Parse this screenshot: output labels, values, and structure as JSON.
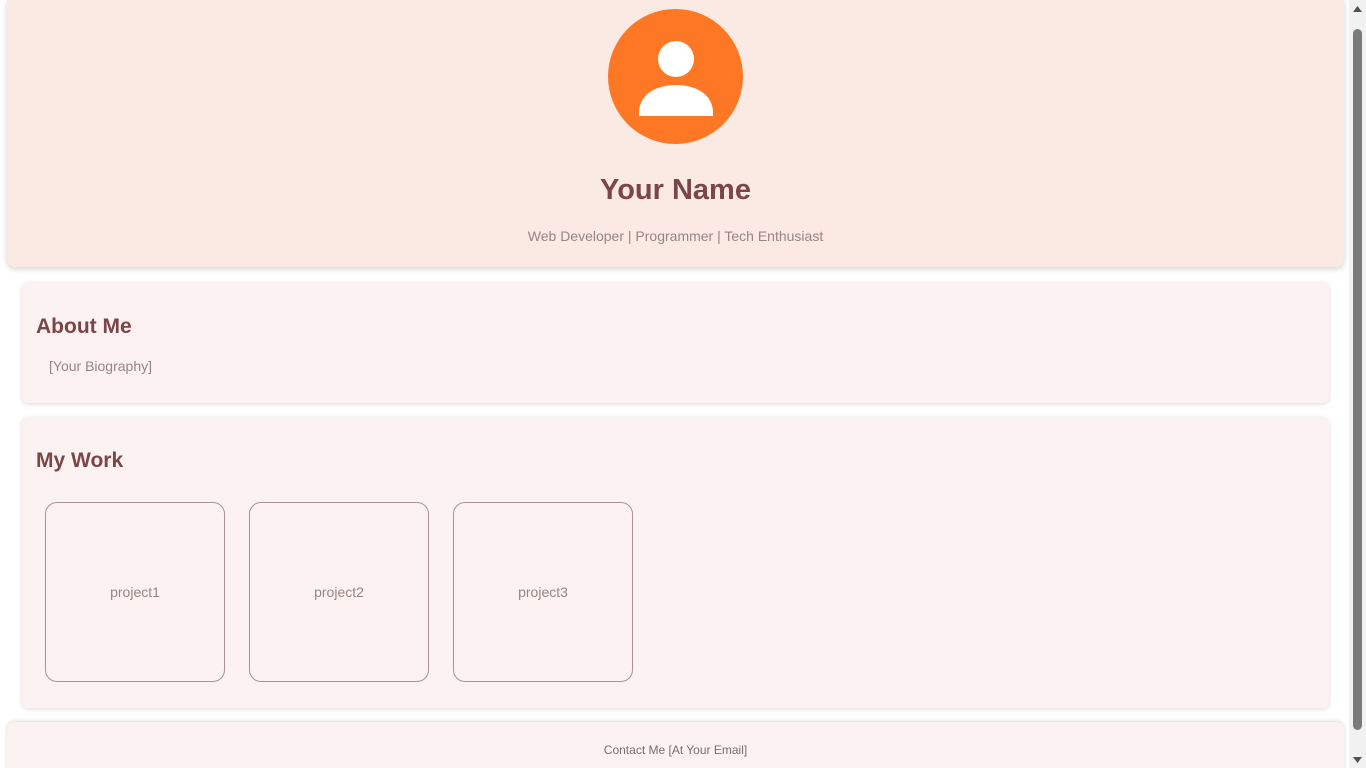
{
  "header": {
    "avatar_icon": "user-avatar-icon",
    "avatar_color": "#fd7725",
    "name": "Your Name",
    "tagline": "Web Developer | Programmer | Tech Enthusiast"
  },
  "about": {
    "title": "About Me",
    "bio": "[Your Biography]"
  },
  "work": {
    "title": "My Work",
    "projects": [
      {
        "label": "project1"
      },
      {
        "label": "project2"
      },
      {
        "label": "project3"
      }
    ]
  },
  "footer": {
    "contact": "Contact Me [At Your Email]"
  },
  "colors": {
    "header_bg": "#fbe9e3",
    "section_bg": "#fcf2f1",
    "heading": "#7a4648",
    "muted_text": "#9a8385"
  }
}
